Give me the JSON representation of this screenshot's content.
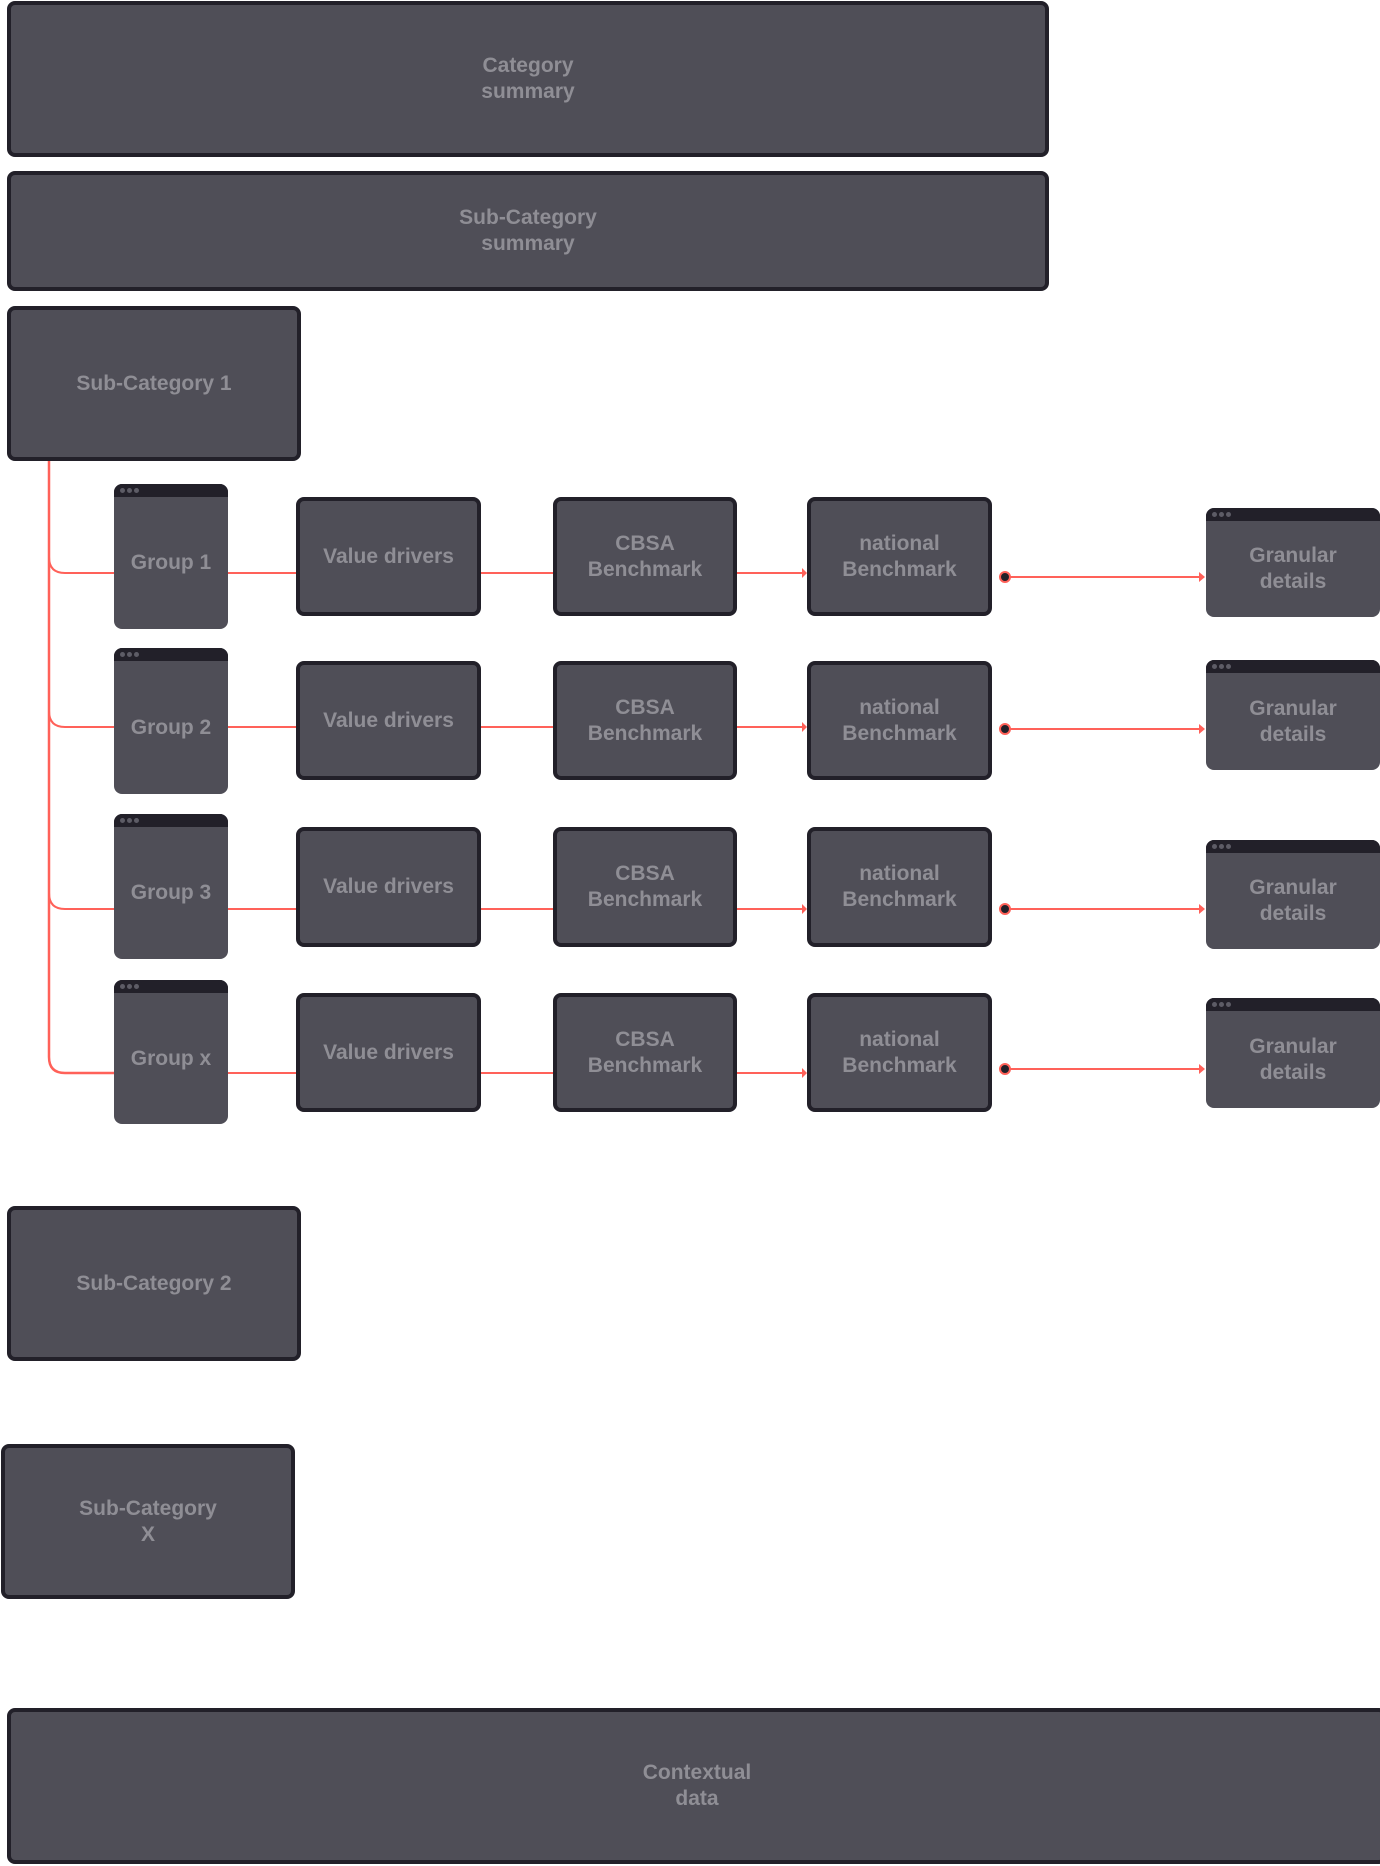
{
  "colors": {
    "box": "#4f4e57",
    "border": "#222029",
    "text": "#8f8e95",
    "connector": "#ff6159"
  },
  "category_summary": "Category\nsummary",
  "subcategory_summary": "Sub-Category\nsummary",
  "subcategories": [
    "Sub-Category 1",
    "Sub-Category 2",
    "Sub-Category\nX"
  ],
  "rows": [
    {
      "group": "Group 1",
      "value": "Value drivers",
      "cbsa": "CBSA\nBenchmark",
      "national": "national\nBenchmark",
      "granular": "Granular\ndetails"
    },
    {
      "group": "Group 2",
      "value": "Value drivers",
      "cbsa": "CBSA\nBenchmark",
      "national": "national\nBenchmark",
      "granular": "Granular\ndetails"
    },
    {
      "group": "Group 3",
      "value": "Value drivers",
      "cbsa": "CBSA\nBenchmark",
      "national": "national\nBenchmark",
      "granular": "Granular\ndetails"
    },
    {
      "group": "Group x",
      "value": "Value drivers",
      "cbsa": "CBSA\nBenchmark",
      "national": "national\nBenchmark",
      "granular": "Granular\ndetails"
    }
  ],
  "contextual": "Contextual\ndata"
}
